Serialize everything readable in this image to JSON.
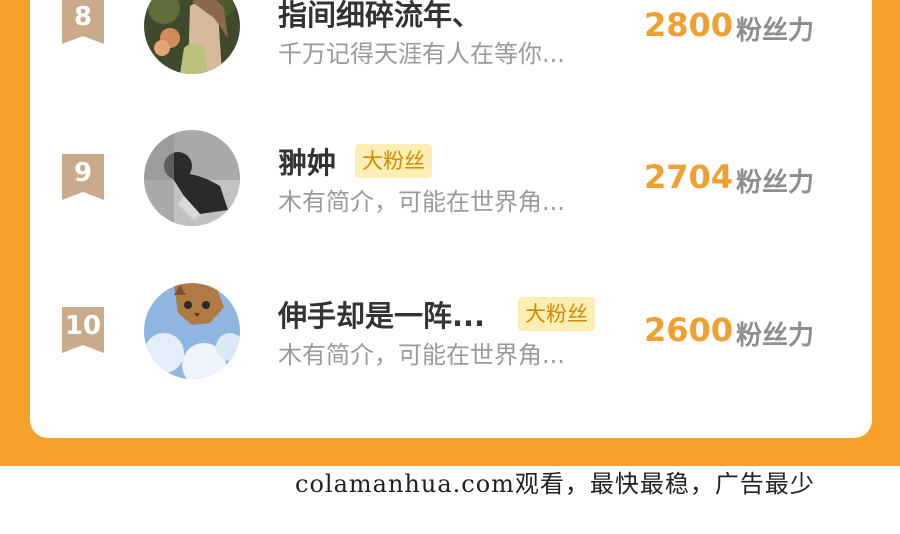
{
  "rows": [
    {
      "rank": "8",
      "name": "指间细碎流年、",
      "tag": "",
      "description": "千万记得天涯有人在等你...",
      "score": "2800",
      "unit": "粉丝力"
    },
    {
      "rank": "9",
      "name": "翀妕",
      "tag": "大粉丝",
      "description": "木有简介，可能在世界角...",
      "score": "2704",
      "unit": "粉丝力"
    },
    {
      "rank": "10",
      "name": "伸手却是一阵...",
      "tag": "大粉丝",
      "description": "木有简介，可能在世界角...",
      "score": "2600",
      "unit": "粉丝力"
    }
  ],
  "footer_text": "colamanhua.com观看，最快最稳，广告最少",
  "colors": {
    "page_background": "#f7a12d",
    "card": "#ffffff",
    "score": "#f0a031",
    "tag_background": "#fdefb4",
    "tag_text": "#d08a00",
    "rank_badge": "#c9ab8c"
  }
}
